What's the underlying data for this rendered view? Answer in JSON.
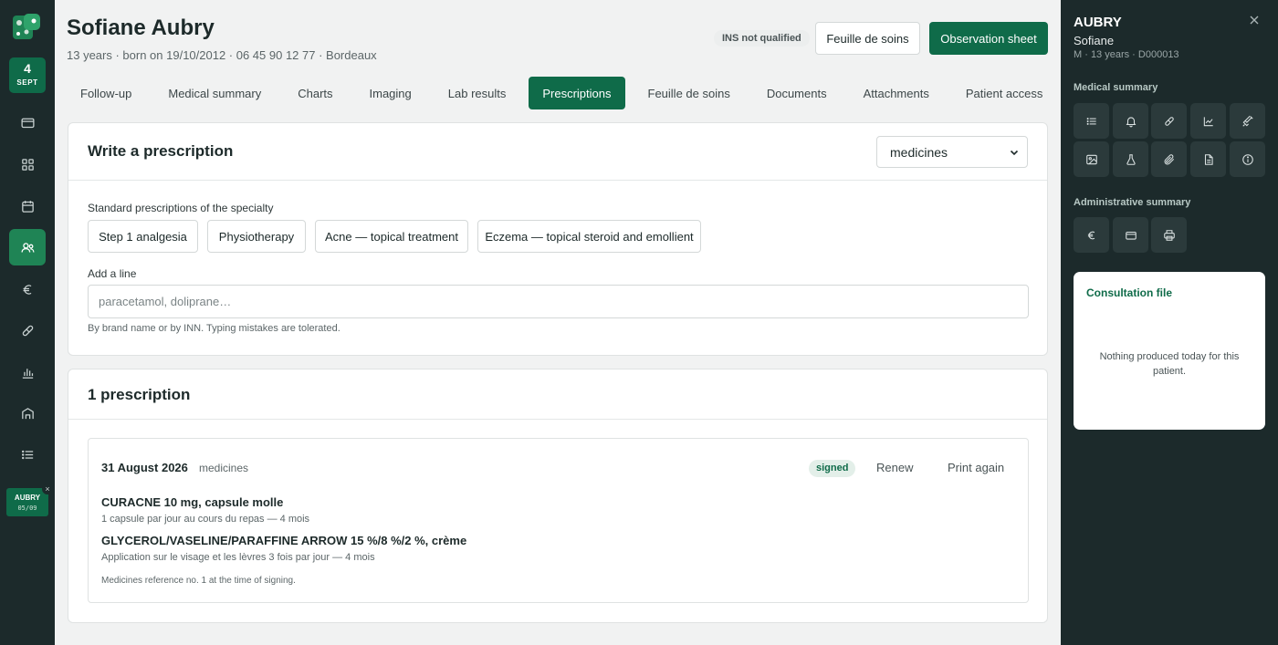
{
  "rail": {
    "date_day": "4",
    "date_month": "SEPT",
    "icons": [
      "logo-icon",
      "credit-card-icon",
      "grid-icon",
      "calendar-icon",
      "users-icon",
      "euro-icon",
      "pill-icon",
      "bar-chart-icon",
      "building-icon",
      "list-icon"
    ],
    "active_icon": "users-icon",
    "open_patient": {
      "name": "AUBRY",
      "date": "05/09",
      "close_label": "×"
    }
  },
  "header": {
    "patient_name": "Sofiane Aubry",
    "patient_meta": "13 years · born on 19/10/2012 · 06 45 90 12 77 · Bordeaux",
    "ins_badge": "INS not qualified",
    "btn_feuille": "Feuille de soins",
    "btn_observation": "Observation sheet"
  },
  "tabs": [
    {
      "label": "Follow-up"
    },
    {
      "label": "Medical summary"
    },
    {
      "label": "Charts"
    },
    {
      "label": "Imaging"
    },
    {
      "label": "Lab results"
    },
    {
      "label": "Prescriptions"
    },
    {
      "label": "Feuille de soins"
    },
    {
      "label": "Documents"
    },
    {
      "label": "Attachments"
    },
    {
      "label": "Patient access"
    }
  ],
  "active_tab": "Prescriptions",
  "write": {
    "title": "Write a prescription",
    "type_select": "medicines",
    "standard_label": "Standard prescriptions of the specialty",
    "chips": [
      "Step 1 analgesia",
      "Physiotherapy",
      "Acne — topical treatment",
      "Eczema — topical steroid and emollient"
    ],
    "add_line_label": "Add a line",
    "add_line_placeholder": "paracetamol, doliprane…",
    "add_line_hint": "By brand name or by INN. Typing mistakes are tolerated."
  },
  "history": {
    "title": "1 prescription",
    "items": [
      {
        "date": "31 August 2026",
        "type": "medicines",
        "status": "signed",
        "renew": "Renew",
        "print_again": "Print again",
        "lines": [
          {
            "drug": "CURACNE 10 mg, capsule molle",
            "dose": "1 capsule par jour au cours du repas — 4 mois"
          },
          {
            "drug": "GLYCEROL/VASELINE/PARAFFINE ARROW 15 %/8 %/2 %, crème",
            "dose": "Application sur le visage et les lèvres 3 fois par jour — 4 mois"
          }
        ],
        "reference": "Medicines reference no. 1 at the time of signing."
      }
    ]
  },
  "side": {
    "last_name": "AUBRY",
    "first_name": "Sofiane",
    "meta": "M · 13 years · D000013",
    "close_label": "×",
    "medical_summary_label": "Medical summary",
    "medical_icons": [
      "list-icon",
      "bell-icon",
      "pill-icon",
      "line-chart-icon",
      "syringe-icon",
      "image-icon",
      "flask-icon",
      "paperclip-icon",
      "file-icon",
      "info-icon"
    ],
    "administrative_label": "Administrative summary",
    "admin_icons": [
      "euro-icon",
      "credit-card-icon",
      "printer-icon"
    ],
    "consultation_title": "Consultation file",
    "consultation_empty": "Nothing produced today for this patient."
  },
  "colors": {
    "brand_green": "#0f6b49",
    "rail_bg": "#1c2a2b",
    "active_rail": "#1f8455"
  }
}
